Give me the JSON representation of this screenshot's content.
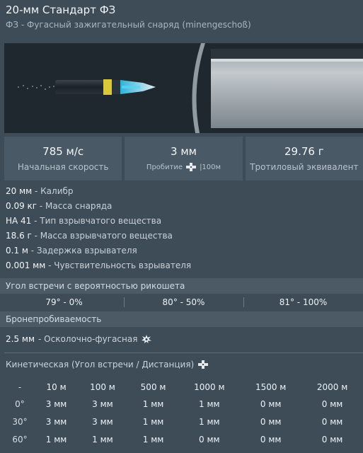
{
  "header": {
    "title": "20-мм Стандарт ФЗ",
    "subtitle": "ФЗ - Фугасный зажигательный снаряд (minengeschoß)"
  },
  "stats": [
    {
      "value": "785 м/с",
      "label": "Начальная скорость"
    },
    {
      "value": "3 мм",
      "label_prefix": "Пробитие",
      "label_suffix": "|100м",
      "icon": "armor-pierce-icon"
    },
    {
      "value": "29.76 г",
      "label": "Тротиловый эквивалент"
    }
  ],
  "properties": [
    {
      "value": "20 мм",
      "label": " - Калибр"
    },
    {
      "value": "0.09 кг",
      "label": " - Масса снаряда"
    },
    {
      "value": "НА 41",
      "label": " - Тип взрывчатого вещества"
    },
    {
      "value": "18.6 г",
      "label": " - Масса взрывчатого вещества"
    },
    {
      "value": "0.1 м",
      "label": " - Задержка взрывателя"
    },
    {
      "value": "0.001 мм",
      "label": " - Чувствительность взрывателя"
    }
  ],
  "ricochet": {
    "header": "Угол встречи с вероятностью рикошета",
    "values": [
      "79° - 0%",
      "80° - 50%",
      "81° - 100%"
    ]
  },
  "penetration": {
    "header": "Бронепробиваемость",
    "he_value": "2.5 мм",
    "he_label": " - Осколочно-фугасная",
    "kinetic_title": "Кинетическая (Угол встречи / Дистанция)",
    "columns": [
      "-",
      "10 м",
      "100 м",
      "500 м",
      "1000 м",
      "1500 м",
      "2000 м"
    ],
    "rows": [
      {
        "angle": "0°",
        "values": [
          "3 мм",
          "3 мм",
          "1 мм",
          "1 мм",
          "0 мм",
          "0 мм"
        ]
      },
      {
        "angle": "30°",
        "values": [
          "3 мм",
          "3 мм",
          "1 мм",
          "1 мм",
          "0 мм",
          "0 мм"
        ]
      },
      {
        "angle": "60°",
        "values": [
          "1 мм",
          "1 мм",
          "1 мм",
          "0 мм",
          "0 мм",
          "0 мм"
        ]
      }
    ]
  },
  "colors": {
    "background": "#3e4c58",
    "panel": "#4a5966",
    "projectile_tip": "#4ec8e8",
    "projectile_band": "#d8c83a"
  }
}
